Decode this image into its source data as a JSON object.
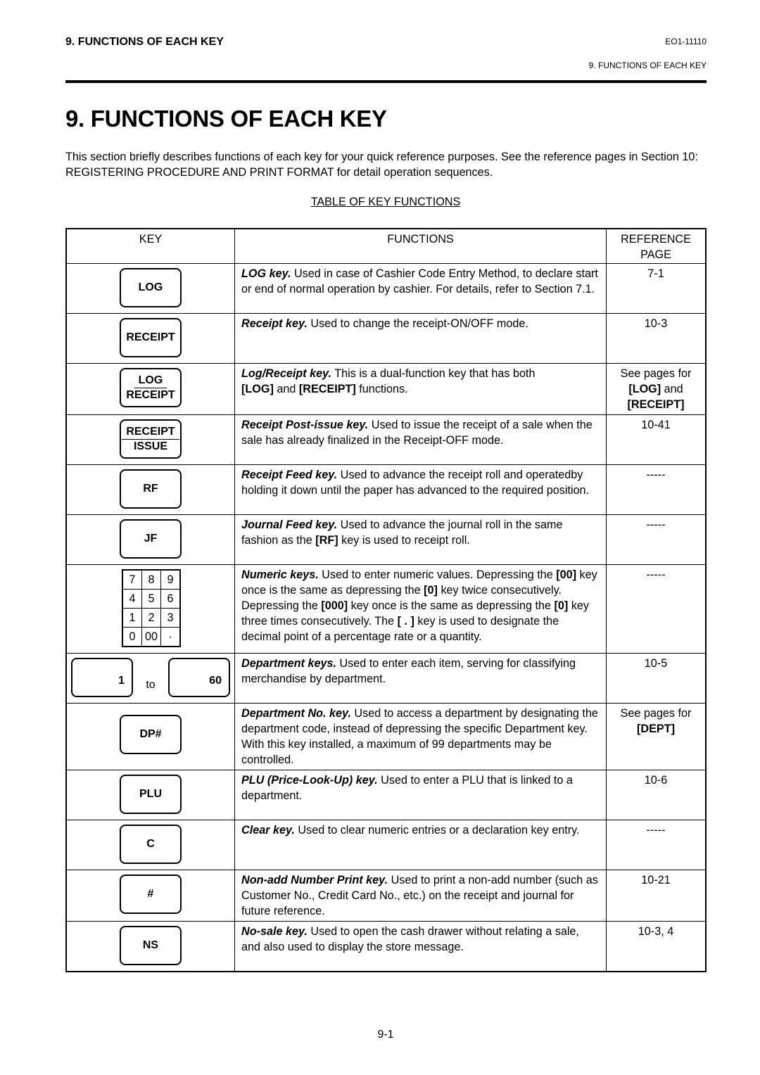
{
  "header": {
    "section_label": "9.  FUNCTIONS OF EACH KEY",
    "doc_code": "EO1-11110",
    "running_title": "9.  FUNCTIONS OF EACH KEY"
  },
  "page_title": "9.  FUNCTIONS OF EACH KEY",
  "intro": "This section briefly describes functions of each key for your quick reference purposes.  See the reference pages in Section 10: REGISTERING PROCEDURE AND PRINT FORMAT for detail operation sequences.",
  "table": {
    "title": "TABLE OF KEY FUNCTIONS",
    "headers": {
      "key": "KEY",
      "functions": "FUNCTIONS",
      "reference": "REFERENCE PAGE"
    },
    "rows": [
      {
        "key": "LOG",
        "lead": "LOG key.",
        "text": "  Used in case of Cashier Code Entry Method, to declare start or end of normal operation by cashier.  For details, refer to Section 7.1.",
        "ref": "7-1"
      },
      {
        "key": "RECEIPT",
        "lead": "Receipt key.",
        "text": "  Used to change the receipt-ON/OFF mode.",
        "ref": "10-3"
      },
      {
        "key_top": "LOG",
        "key_bottom": "RECEIPT",
        "lead": "Log/Receipt key.",
        "text": "  This is a dual-function key that has both",
        "kw1": "[LOG]",
        "mid": " and ",
        "kw2": "[RECEIPT]",
        "tail": " functions.",
        "ref_line1": "See pages for",
        "ref_kw1": "[LOG]",
        "ref_and": " and",
        "ref_kw2": "[RECEIPT]"
      },
      {
        "key_top": "RECEIPT",
        "key_bottom": "ISSUE",
        "lead": "Receipt Post-issue key.",
        "text": "  Used to issue the receipt of a sale when the sale has already finalized in the Receipt-OFF mode.",
        "ref": "10-41"
      },
      {
        "key": "RF",
        "lead": "Receipt Feed key.",
        "text": "  Used to advance the receipt roll and operatedby holding it down until the paper has advanced to the required position.",
        "ref": "-----"
      },
      {
        "key": "JF",
        "lead": "Journal Feed key.",
        "text": "  Used to advance the journal roll in the same fashion as the ",
        "kw1": "[RF]",
        "tail": " key is used to receipt roll.",
        "ref": "-----"
      },
      {
        "numpad": [
          [
            "7",
            "8",
            "9"
          ],
          [
            "4",
            "5",
            "6"
          ],
          [
            "1",
            "2",
            "3"
          ],
          [
            "0",
            "00",
            "·"
          ]
        ],
        "lead": "Numeric keys.",
        "t1": "  Used to enter numeric values. Depressing the ",
        "k1": "[00]",
        "t2": " key once is the same as depressing the ",
        "k2": "[0]",
        "t3": " key twice consecutively.  Depressing the ",
        "k3": "[000]",
        "t4": " key once is the same as depressing the ",
        "k4": "[0]",
        "t5": " key three times consecutively. The ",
        "k5": "[ . ]",
        "t6": " key is used to designate the decimal point of a percentage rate or a quantity.",
        "ref": "-----"
      },
      {
        "dept_from": "1",
        "dept_to_label": "to",
        "dept_to": "60",
        "lead": "Department keys.",
        "text": "  Used to enter each item, serving for classifying merchandise by department.",
        "ref": "10-5"
      },
      {
        "key": "DP#",
        "lead": "Department No. key.",
        "text": "  Used to access a department by designating the department code, instead of depressing the specific Department key. With this key installed, a maximum of 99 departments may be controlled.",
        "ref_line1": "See pages for",
        "ref_kw1": "[DEPT]"
      },
      {
        "key": "PLU",
        "lead": "PLU (Price-Look-Up) key.",
        "text": "  Used to enter a PLU that is linked to a department.",
        "ref": "10-6"
      },
      {
        "key": "C",
        "lead": "Clear key.",
        "text": "  Used to clear numeric entries or a declaration key entry.",
        "ref": "-----"
      },
      {
        "key": "#",
        "lead": "Non-add Number Print key.",
        "text": "  Used to print a non-add number (such as Customer No., Credit Card No., etc.) on the receipt and journal for future reference.",
        "ref": "10-21"
      },
      {
        "key": "NS",
        "lead": "No-sale key.",
        "text": "  Used to open the cash drawer without relating a sale, and also used to display the store message.",
        "ref": "10-3, 4"
      }
    ]
  },
  "footer": {
    "page_number": "9-1"
  }
}
